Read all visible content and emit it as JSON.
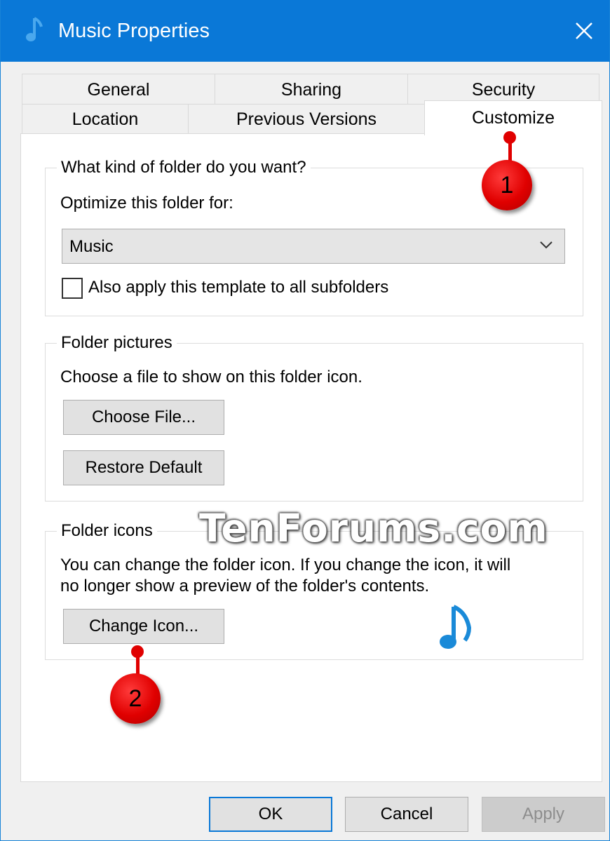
{
  "window": {
    "title": "Music Properties",
    "title_icon": "music-note-icon",
    "close_icon": "close-icon"
  },
  "tabs": {
    "row1": [
      "General",
      "Sharing",
      "Security"
    ],
    "row2": [
      "Location",
      "Previous Versions",
      "Customize"
    ],
    "active": "Customize"
  },
  "folder_kind": {
    "legend": "What kind of folder do you want?",
    "optimize_label": "Optimize this folder for:",
    "optimize_value": "Music",
    "apply_subfolders_label": "Also apply this template to all subfolders",
    "apply_subfolders_checked": false
  },
  "folder_pictures": {
    "legend": "Folder pictures",
    "description": "Choose a file to show on this folder icon.",
    "choose_file_button": "Choose File...",
    "restore_default_button": "Restore Default"
  },
  "folder_icons": {
    "legend": "Folder icons",
    "description_line1": "You can change the folder icon. If you change the icon, it will",
    "description_line2": "no longer show a preview of the folder's contents.",
    "change_icon_button": "Change Icon...",
    "preview_icon": "music-note-icon"
  },
  "footer": {
    "ok": "OK",
    "cancel": "Cancel",
    "apply": "Apply"
  },
  "watermark": "TenForums.com",
  "callouts": [
    "1",
    "2"
  ],
  "colors": {
    "title_bar": "#0a78d7",
    "accent": "#0a78d7",
    "callout": "#e00000",
    "note": "#1a8ad8"
  }
}
